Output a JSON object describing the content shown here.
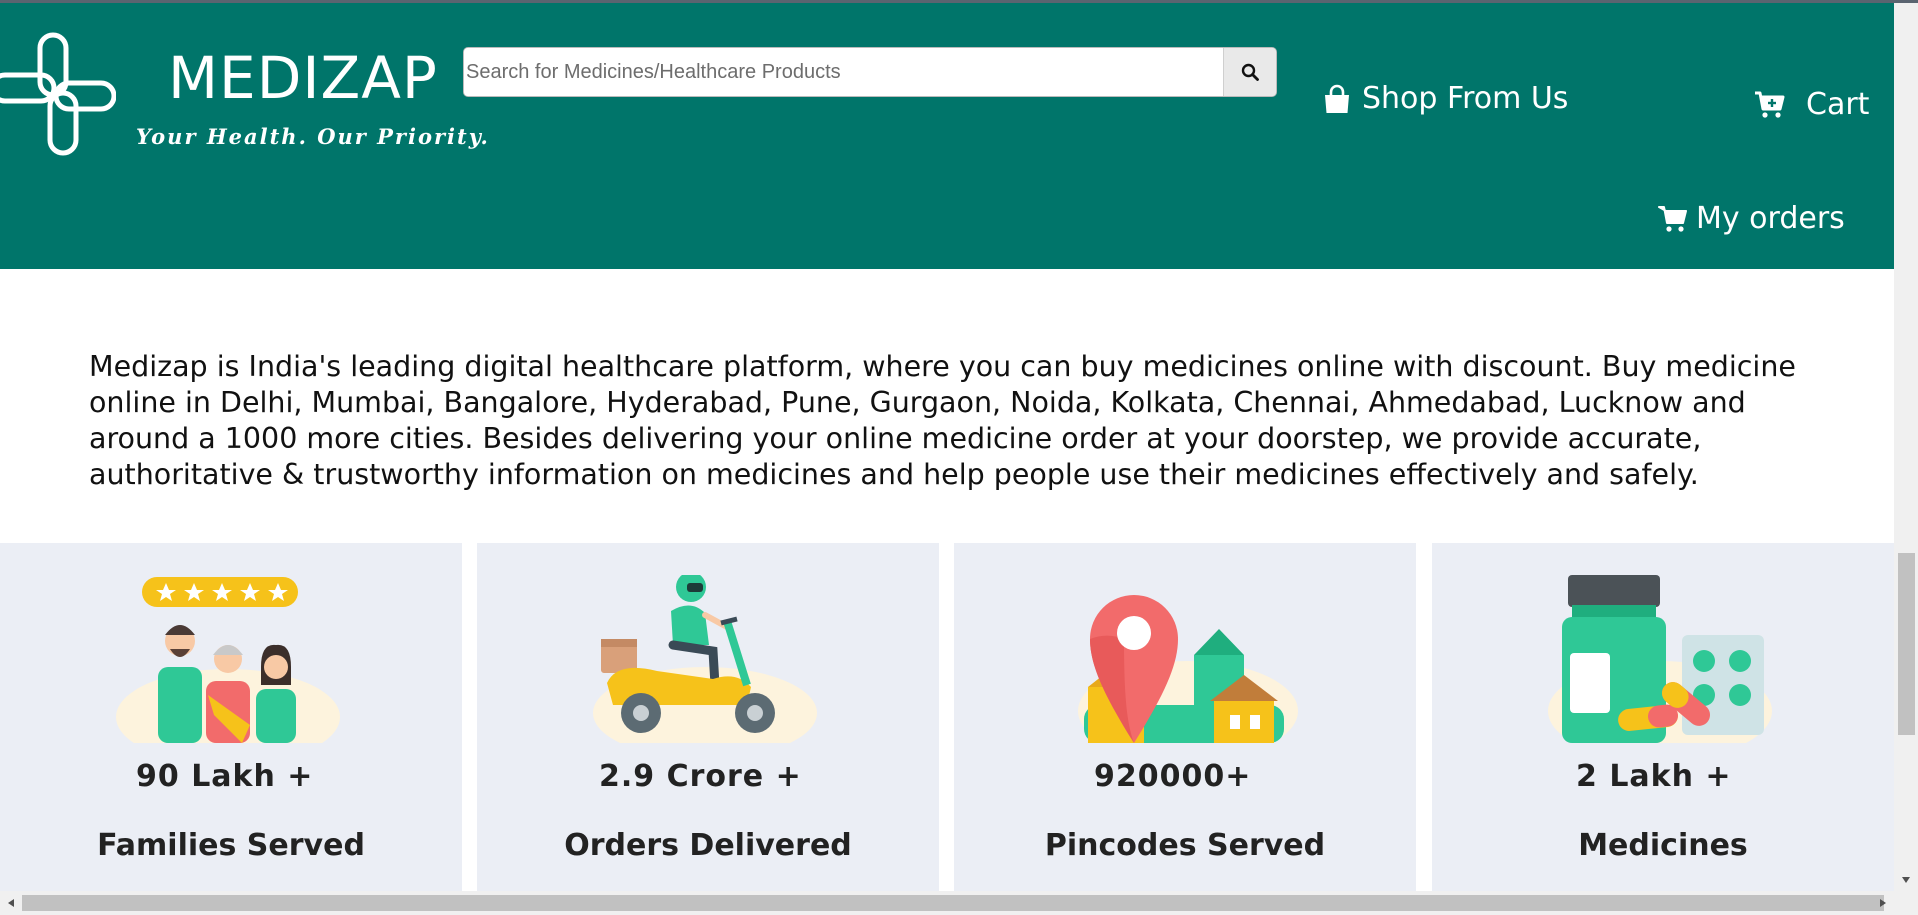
{
  "header": {
    "brand": "MEDIZAP",
    "tagline": "Your Health. Our Priority.",
    "search_placeholder": "Search for Medicines/Healthcare Products",
    "nav": {
      "shop": "Shop From Us",
      "cart": "Cart",
      "orders": "My orders"
    }
  },
  "intro": "Medizap is India's leading digital healthcare platform, where you can buy medicines online with discount. Buy medicine online in Delhi, Mumbai, Bangalore, Hyderabad, Pune, Gurgaon, Noida, Kolkata, Chennai, Ahmedabad, Lucknow and around a 1000 more cities. Besides delivering your online medicine order at your doorstep, we provide accurate, authoritative & trustworthy information on medicines and help people use their medicines effectively and safely.",
  "stats": [
    {
      "value": "90 Lakh +",
      "label": "Families Served",
      "illustration": "family-rating-illustration"
    },
    {
      "value": "2.9 Crore +",
      "label": "Orders Delivered",
      "illustration": "delivery-scooter-illustration"
    },
    {
      "value": "920000+",
      "label": "Pincodes Served",
      "illustration": "location-pin-illustration"
    },
    {
      "value": "2 Lakh +",
      "label": "Medicines",
      "illustration": "medicine-bottle-illustration"
    }
  ],
  "colors": {
    "header_bg": "#00756a",
    "card_bg": "#ebeef5",
    "accent_teal": "#2fc896",
    "accent_yellow": "#f6c21a",
    "pin_red": "#f26b6b"
  }
}
